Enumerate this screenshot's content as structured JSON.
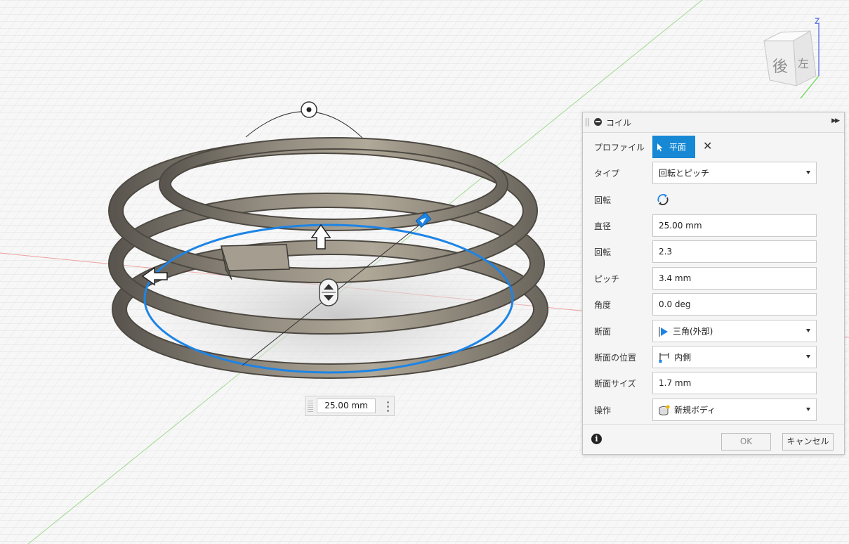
{
  "viewcube": {
    "face_back": "後",
    "face_left": "左",
    "axis_z": "Z"
  },
  "dimension": {
    "value": "25.00 mm"
  },
  "dialog": {
    "title": "コイル",
    "rows": {
      "profile": {
        "label": "プロファイル",
        "button": "平面"
      },
      "type": {
        "label": "タイプ",
        "value": "回転とピッチ"
      },
      "rotation_dir": {
        "label": "回転"
      },
      "diameter": {
        "label": "直径",
        "value": "25.00 mm"
      },
      "revolutions": {
        "label": "回転",
        "value": "2.3"
      },
      "pitch": {
        "label": "ピッチ",
        "value": "3.4 mm"
      },
      "angle": {
        "label": "角度",
        "value": "0.0 deg"
      },
      "section": {
        "label": "断面",
        "value": "三角(外部)"
      },
      "section_position": {
        "label": "断面の位置",
        "value": "内側"
      },
      "section_size": {
        "label": "断面サイズ",
        "value": "1.7 mm"
      },
      "operation": {
        "label": "操作",
        "value": "新規ボディ"
      }
    },
    "ok": "OK",
    "cancel": "キャンセル"
  },
  "colors": {
    "accent": "#1788d4",
    "selection": "#1d84e6",
    "coil": "#8a8478"
  },
  "icons": {
    "header": "minus-circle-icon",
    "expand": "double-chevron-right-icon",
    "profile": "cursor-arrow-icon",
    "clear": "close-icon",
    "rotation": "rotate-arrows-icon",
    "section": "triangle-icon",
    "position": "inside-position-icon",
    "operation": "new-body-icon",
    "info": "info-icon",
    "dropdown": "chevron-down-icon"
  }
}
